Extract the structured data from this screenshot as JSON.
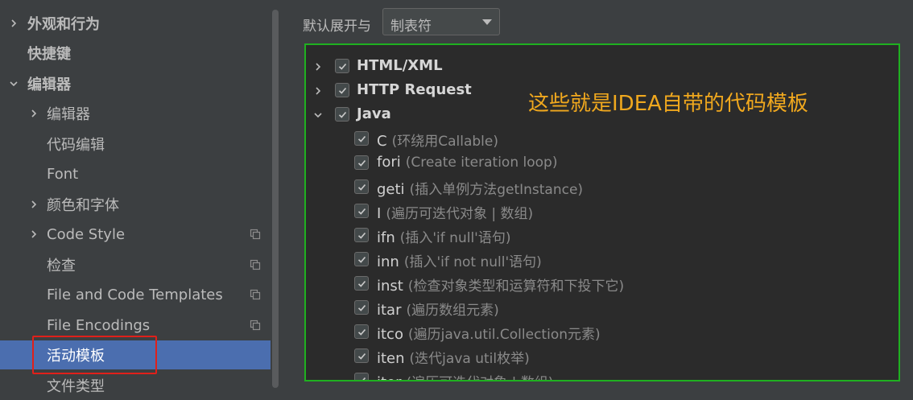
{
  "sidebar": {
    "items": [
      {
        "label": "外观和行为",
        "expandable": true,
        "expanded": false,
        "level": 0,
        "bold": true
      },
      {
        "label": "快捷键",
        "expandable": false,
        "level": 0,
        "bold": true
      },
      {
        "label": "编辑器",
        "expandable": true,
        "expanded": true,
        "level": 0,
        "bold": true
      },
      {
        "label": "编辑器",
        "expandable": true,
        "expanded": false,
        "level": 1
      },
      {
        "label": "代码编辑",
        "expandable": false,
        "level": 1
      },
      {
        "label": "Font",
        "expandable": false,
        "level": 1
      },
      {
        "label": "颜色和字体",
        "expandable": true,
        "expanded": false,
        "level": 1
      },
      {
        "label": "Code Style",
        "expandable": true,
        "expanded": false,
        "level": 1,
        "project_icon": "copy-icon"
      },
      {
        "label": "检查",
        "expandable": false,
        "level": 1,
        "project_icon": "copy-icon"
      },
      {
        "label": "File and Code Templates",
        "expandable": false,
        "level": 1,
        "project_icon": "copy-icon"
      },
      {
        "label": "File Encodings",
        "expandable": false,
        "level": 1,
        "project_icon": "copy-icon"
      },
      {
        "label": "活动模板",
        "expandable": false,
        "level": 1,
        "selected": true
      },
      {
        "label": "文件类型",
        "expandable": false,
        "level": 1
      }
    ]
  },
  "expand_with": {
    "label": "默认展开与",
    "value": "制表符"
  },
  "templates": {
    "groups": [
      {
        "name": "HTML/XML",
        "checked": true,
        "expanded": false
      },
      {
        "name": "HTTP Request",
        "checked": true,
        "expanded": false
      },
      {
        "name": "Java",
        "checked": true,
        "expanded": true
      }
    ],
    "java_items": [
      {
        "abbr": "C",
        "desc": "(环绕用Callable)",
        "checked": true
      },
      {
        "abbr": "fori",
        "desc": "(Create iteration loop)",
        "checked": true
      },
      {
        "abbr": "geti",
        "desc": "(插入单例方法getInstance)",
        "checked": true
      },
      {
        "abbr": "I",
        "desc": "(遍历可迭代对象 | 数组)",
        "checked": true
      },
      {
        "abbr": "ifn",
        "desc": "(插入'if null'语句)",
        "checked": true
      },
      {
        "abbr": "inn",
        "desc": "(插入'if not null'语句)",
        "checked": true
      },
      {
        "abbr": "inst",
        "desc": "(检查对象类型和运算符和下投下它)",
        "checked": true
      },
      {
        "abbr": "itar",
        "desc": "(遍历数组元素)",
        "checked": true
      },
      {
        "abbr": "itco",
        "desc": "(遍历java.util.Collection元素)",
        "checked": true
      },
      {
        "abbr": "iten",
        "desc": "(迭代java util枚举)",
        "checked": true
      },
      {
        "abbr": "iter",
        "desc": "(遍历可迭代对象 | 数组)",
        "checked": true
      }
    ]
  },
  "annotation": "这些就是IDEA自带的代码模板",
  "colors": {
    "selection": "#4b6eaf",
    "annotation": "#f0a81e",
    "highlight_green": "#1fb020",
    "highlight_red": "#e0201a"
  }
}
